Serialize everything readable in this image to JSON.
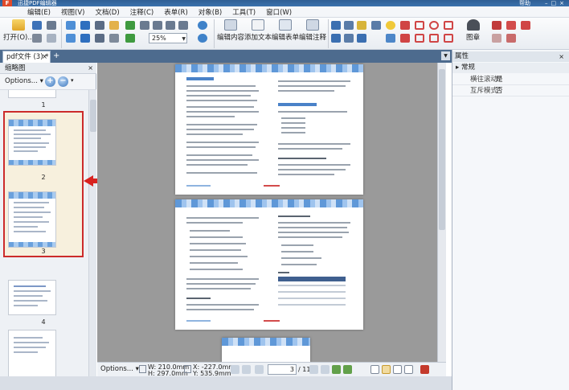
{
  "window": {
    "title": "迅捷PDF编辑器",
    "register": "帮助",
    "app_icon": "F"
  },
  "menu": [
    "编辑(E)",
    "视图(V)",
    "文档(D)",
    "注释(C)",
    "表单(R)",
    "对象(B)",
    "工具(T)",
    "窗口(W)"
  ],
  "toolbar": {
    "open_label": "打开(O)...",
    "zoom_value": "25%",
    "edit_content": "编辑内容",
    "add_text": "添加文本",
    "edit_form": "编辑表单",
    "edit_annot": "编辑注释",
    "stamp": "图章"
  },
  "tabs": {
    "doc_tab": "pdf文件 (3) *",
    "add_tab": "+",
    "close_tab": "×"
  },
  "thumbnails": {
    "title": "缩略图",
    "options": "Options...",
    "zoom_in": "+",
    "zoom_out": "−",
    "pages": [
      {
        "num": "1"
      },
      {
        "num": "2"
      },
      {
        "num": "3"
      },
      {
        "num": "4"
      }
    ]
  },
  "status": {
    "options": "Options...",
    "width": "W: 210.0mm",
    "height": "H: 297.0mm",
    "x": "X: -227.0mm",
    "y": "Y: 535.9mm",
    "page_field": "3",
    "page_total": "/ 11"
  },
  "properties": {
    "title": "属性",
    "section": "常规",
    "rows": [
      {
        "key": "横往滚动",
        "value": "是"
      },
      {
        "key": "互斥模式",
        "value": "否"
      }
    ]
  },
  "colors": {
    "accent": "#3a6aa3",
    "selection_border": "#cc2b2b",
    "tab_strip": "#4d6b8e"
  }
}
